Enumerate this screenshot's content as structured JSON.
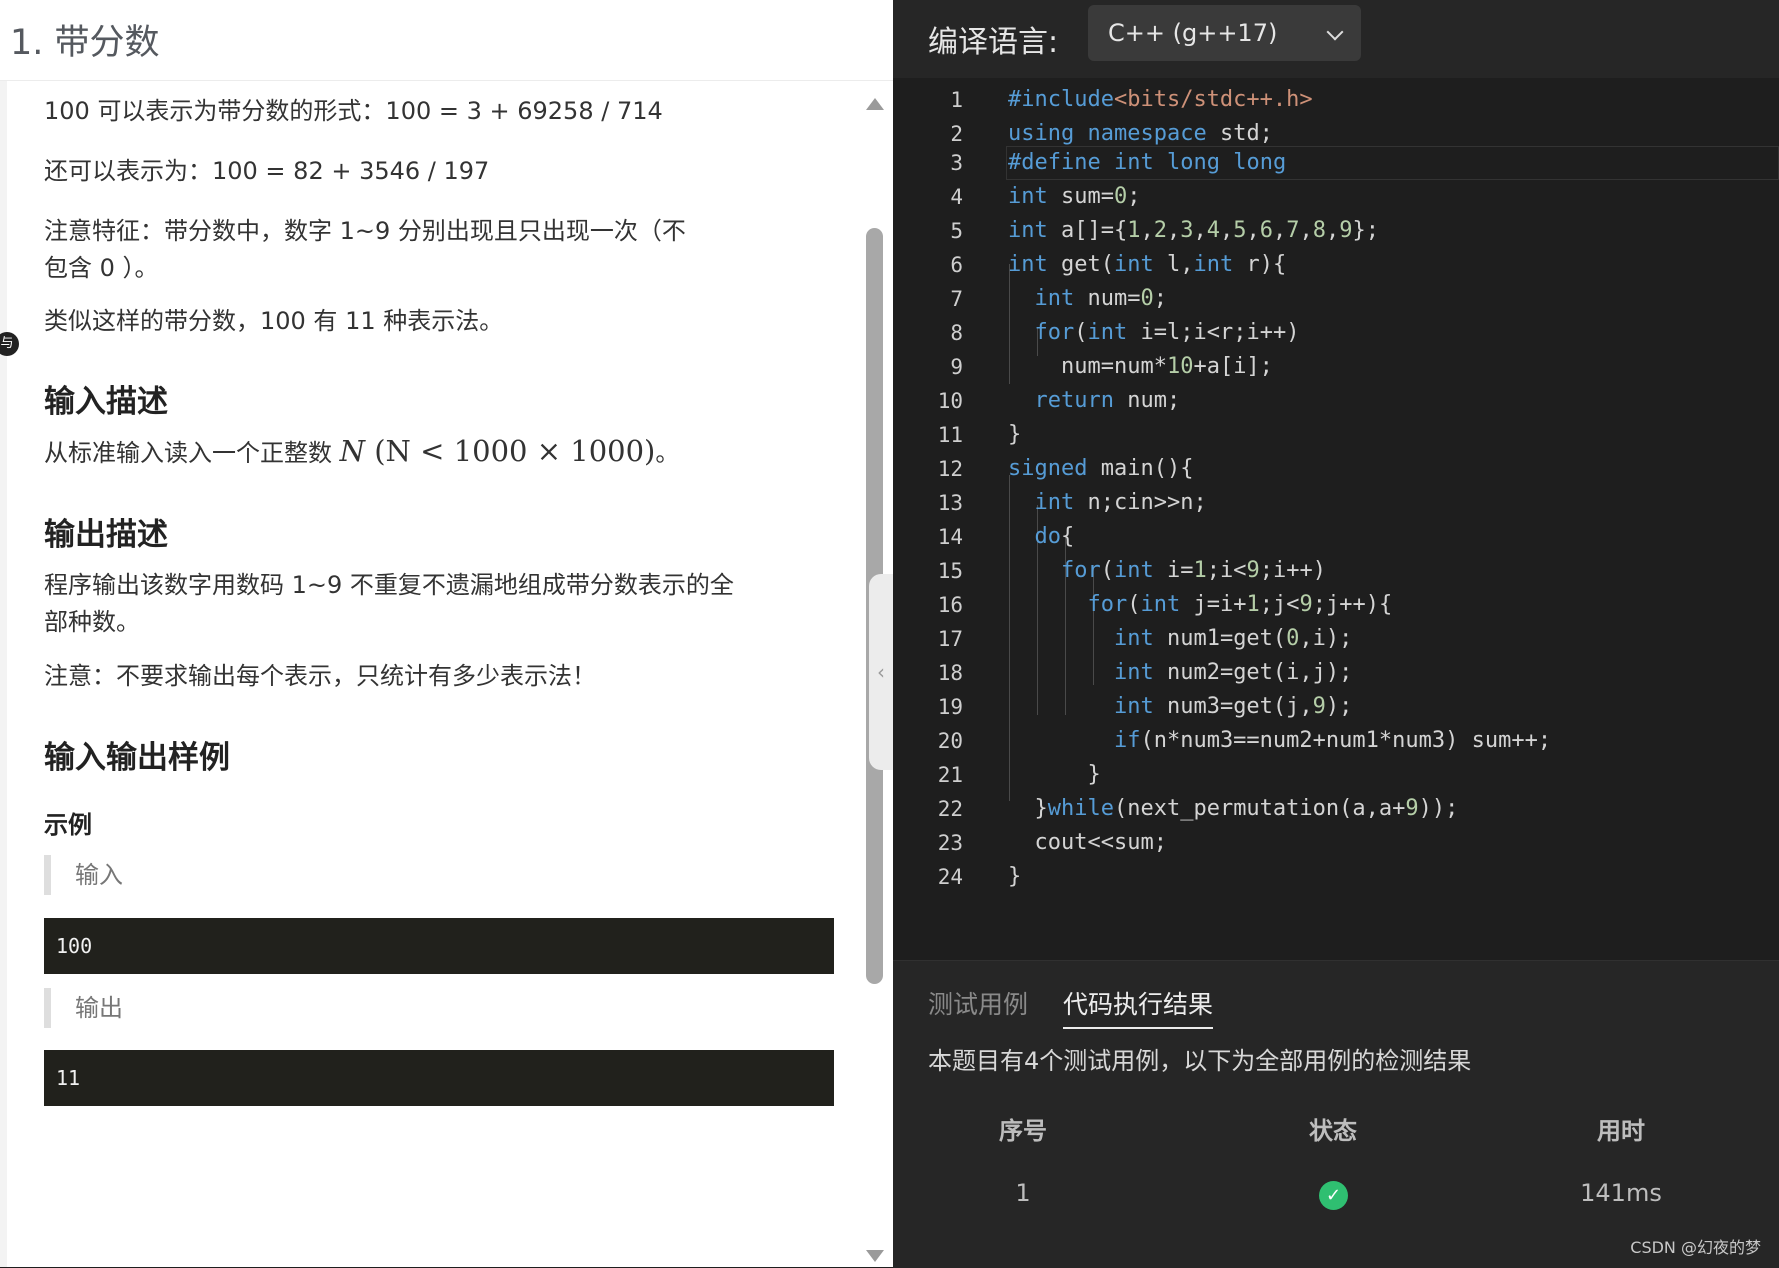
{
  "problem": {
    "title": "1. 带分数",
    "paragraphs": [
      "100 可以表示为带分数的形式：100 = 3 + 69258 / 714",
      "还可以表示为：100 = 82 + 3546 / 197",
      "注意特征：带分数中，数字 1~9 分别出现且只出现一次（不包含 0 ）。",
      "类似这样的带分数，100 有 11 种表示法。"
    ],
    "input_heading": "输入描述",
    "input_text": "从标准输入读入一个正整数",
    "input_math": {
      "var": "N",
      "cond_left": "(N",
      "lt": "<",
      "a": "1000",
      "times": "×",
      "b": "1000)",
      "end": "。"
    },
    "output_heading": "输出描述",
    "output_text": "程序输出该数字用数码 1~9 不重复不遗漏地组成带分数表示的全部种数。",
    "output_note": "注意：不要求输出每个表示，只统计有多少表示法！",
    "sample_heading": "输入输出样例",
    "example_label": "示例",
    "input_label": "输入",
    "input_value": "100",
    "output_label": "输出",
    "output_value": "11",
    "margin_glyph": "与"
  },
  "editor": {
    "lang_label": "编译语言:",
    "lang_selected": "C++ (g++17)",
    "line_numbers": [
      "1",
      "2",
      "3",
      "4",
      "5",
      "6",
      "7",
      "8",
      "9",
      "10",
      "11",
      "12",
      "13",
      "14",
      "15",
      "16",
      "17",
      "18",
      "19",
      "20",
      "21",
      "22",
      "23",
      "24"
    ]
  },
  "results": {
    "tab_tests": "测试用例",
    "tab_output": "代码执行结果",
    "summary": "本题目有4个测试用例，以下为全部用例的检测结果",
    "headers": [
      "序号",
      "状态",
      "用时"
    ],
    "rows": [
      {
        "index": "1",
        "status_icon": "check-circle-icon",
        "time": "141ms"
      }
    ],
    "success_color": "#2fbf71"
  },
  "watermark": "CSDN @幻夜的梦"
}
